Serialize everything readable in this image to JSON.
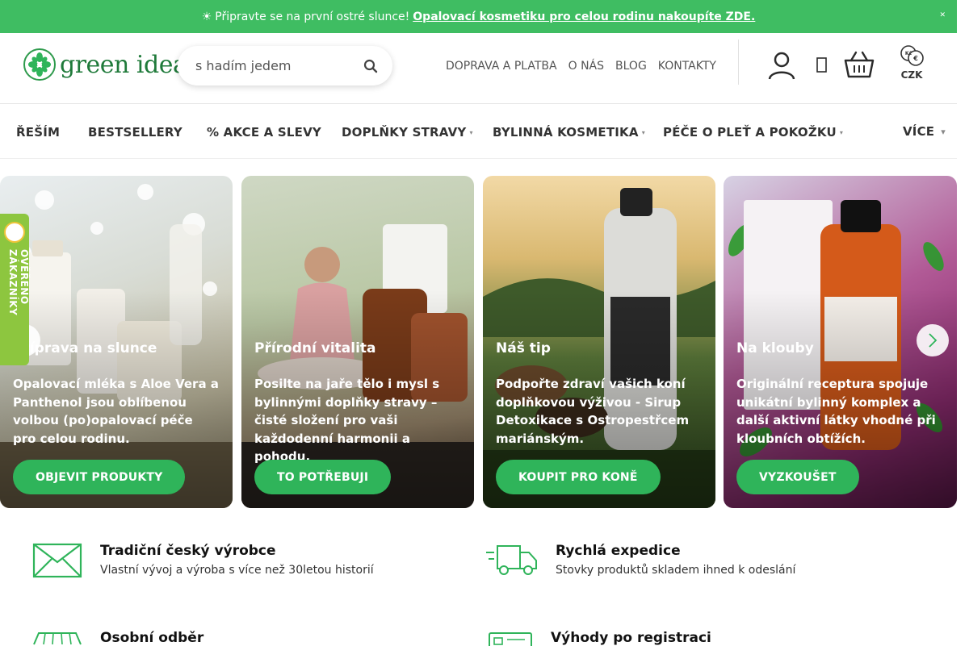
{
  "topbar": {
    "sun_glyph": "☀",
    "text": "Připravte se na první ostré slunce!",
    "link": "Opalovací kosmetiku pro celou rodinu nakoupíte ZDE."
  },
  "header": {
    "logo_text": "green idea",
    "search_value": "s hadím jedem",
    "links": [
      "DOPRAVA A PLATBA",
      "O NÁS",
      "BLOG",
      "KONTAKTY"
    ],
    "currency": "CZK"
  },
  "nav": {
    "items": [
      "ŘEŠÍM",
      "BESTSELLERY",
      "% AKCE A SLEVY",
      "DOPLŇKY STRAVY",
      "BYLINNÁ KOSMETIKA",
      "PÉČE O PLEŤ A POKOŽKU",
      "VÍCE"
    ]
  },
  "verified_tab": "OVĚŘENO ZÁKAZNÍKY",
  "cards": [
    {
      "title": "Příprava na slunce",
      "desc": "Opalovací mléka s Aloe Vera a Panthenol jsou oblíbenou volbou (po)opalovací péče pro celou rodinu.",
      "cta": "OBJEVIT PRODUKTY"
    },
    {
      "title": "Přírodní vitalita",
      "desc": "Posilte na jaře tělo i mysl s bylinnými doplňky stravy – čisté složení pro vaši každodenní harmonii a pohodu.",
      "cta": "TO POTŘEBUJI"
    },
    {
      "title": "Náš tip",
      "desc": "Podpořte zdraví vašich koní doplňkovou výživou - Sirup Detoxikace s Ostropestřcem mariánským.",
      "cta": "KOUPIT PRO KONĚ"
    },
    {
      "title": "Na klouby",
      "desc": "Originální receptura spojuje unikátní bylinný komplex a další aktivní látky vhodné při kloubních obtížích.",
      "cta": "VYZKOUŠET"
    }
  ],
  "features": [
    {
      "title": "Tradiční český výrobce",
      "desc": "Vlastní vývoj a výroba s více než 30letou historií",
      "icon": "envelope-icon"
    },
    {
      "title": "Rychlá expedice",
      "desc": "Stovky produktů skladem ihned k odeslání",
      "icon": "truck-icon"
    },
    {
      "title": "Osobní odběr",
      "desc": "",
      "icon": "store-icon"
    },
    {
      "title": "Výhody po registraci",
      "desc": "",
      "icon": "card-icon"
    }
  ],
  "colors": {
    "brand_green": "#3fbd62",
    "cta_green": "#2fb45a",
    "logo_green": "#1f7a3a",
    "verified_green": "#8dc63f"
  }
}
